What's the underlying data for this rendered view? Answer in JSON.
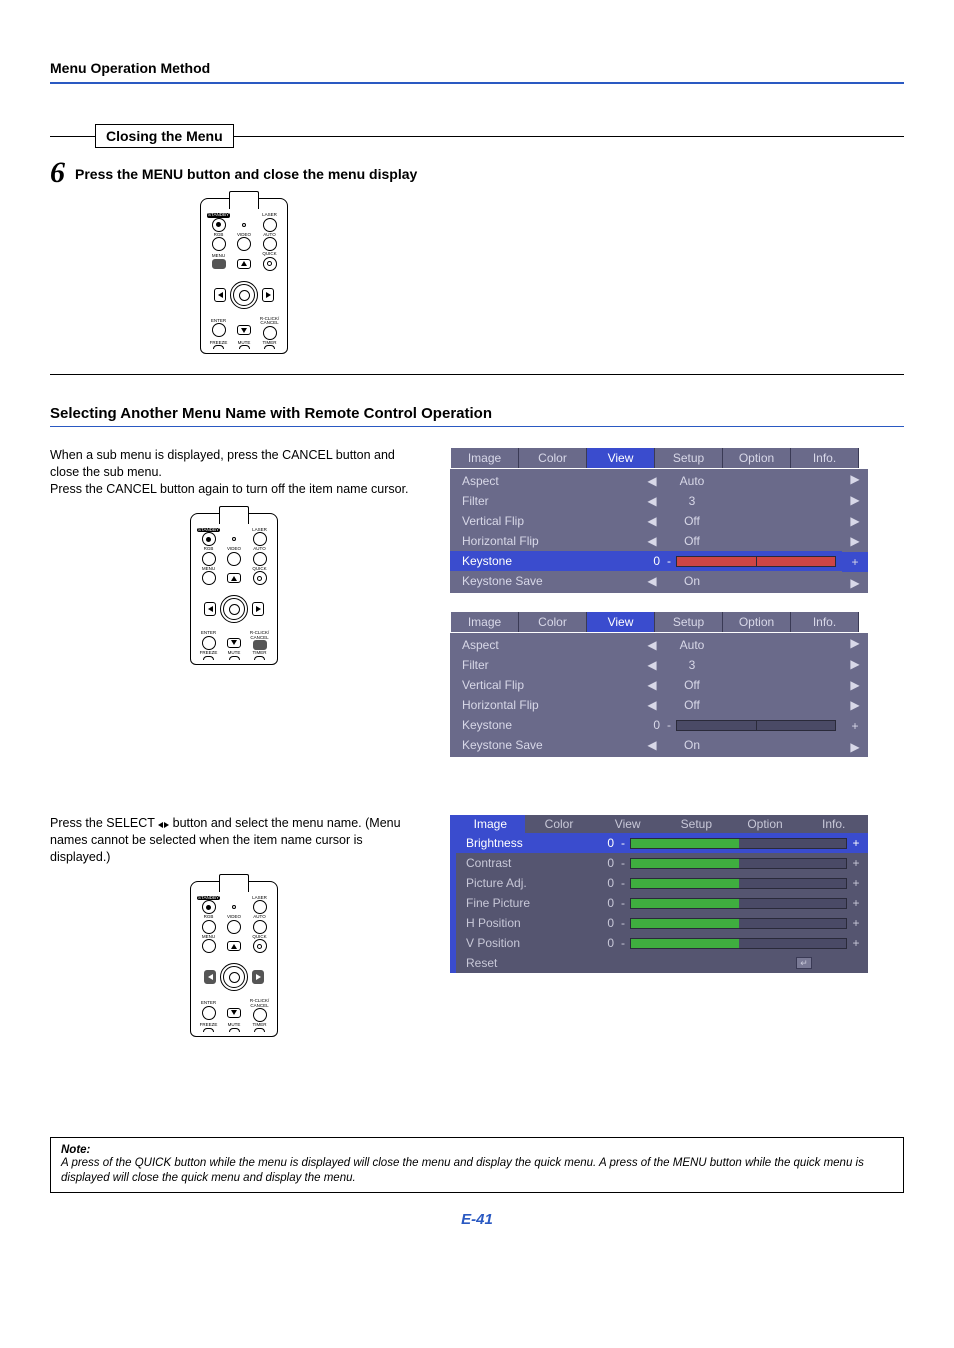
{
  "header": {
    "title": "Menu Operation Method"
  },
  "section1": {
    "boxed_title": "Closing the Menu",
    "step_number": "6",
    "step_text": "Press the MENU button and close the menu display"
  },
  "remote_labels": {
    "standby": "STANDBY",
    "laser": "LASER",
    "rgb": "RGB",
    "video": "VIDEO",
    "auto": "AUTO",
    "menu": "MENU",
    "quick": "QUICK",
    "enter": "ENTER",
    "rclick": "R-CLICK/",
    "cancel": "CANCEL",
    "freeze": "FREEZE",
    "mute": "MUTE",
    "timer": "TIMER"
  },
  "section2": {
    "heading": "Selecting Another Menu Name with Remote Control Operation",
    "para1a": "When a sub menu is displayed, press the CANCEL button and close the sub menu.",
    "para1b": "Press the CANCEL button again to turn off the item name cursor.",
    "para2a": "Press the SELECT ",
    "para2b": " button and select the menu name. (Menu names cannot be selected when the item name cursor is displayed.)"
  },
  "osd_tabs": [
    "Image",
    "Color",
    "View",
    "Setup",
    "Option",
    "Info."
  ],
  "osd1_rows": [
    {
      "label": "Aspect",
      "value": "Auto",
      "type": "lr"
    },
    {
      "label": "Filter",
      "value": "3",
      "type": "lr"
    },
    {
      "label": "Vertical Flip",
      "value": "Off",
      "type": "lr"
    },
    {
      "label": "Horizontal Flip",
      "value": "Off",
      "type": "lr"
    },
    {
      "label": "Keystone",
      "value": "0",
      "type": "slider",
      "selected": true,
      "red": true
    },
    {
      "label": "Keystone Save",
      "value": "On",
      "type": "lr"
    }
  ],
  "osd2_rows": [
    {
      "label": "Aspect",
      "value": "Auto",
      "type": "lr"
    },
    {
      "label": "Filter",
      "value": "3",
      "type": "lr"
    },
    {
      "label": "Vertical Flip",
      "value": "Off",
      "type": "lr"
    },
    {
      "label": "Horizontal Flip",
      "value": "Off",
      "type": "lr"
    },
    {
      "label": "Keystone",
      "value": "0",
      "type": "slider"
    },
    {
      "label": "Keystone Save",
      "value": "On",
      "type": "lr"
    }
  ],
  "osd3_rows": [
    {
      "label": "Brightness",
      "value": "0",
      "type": "slider",
      "selected": true
    },
    {
      "label": "Contrast",
      "value": "0",
      "type": "slider"
    },
    {
      "label": "Picture Adj.",
      "value": "0",
      "type": "slider"
    },
    {
      "label": "Fine Picture",
      "value": "0",
      "type": "slider"
    },
    {
      "label": "H Position",
      "value": "0",
      "type": "slider"
    },
    {
      "label": "V Position",
      "value": "0",
      "type": "slider"
    },
    {
      "label": "Reset",
      "type": "reset"
    }
  ],
  "note": {
    "head": "Note:",
    "text": "A press of the QUICK button while the menu is displayed will close the menu and display the quick menu. A press of the MENU button while the quick menu is displayed will close the quick menu and display the menu."
  },
  "page_number": "E-41"
}
